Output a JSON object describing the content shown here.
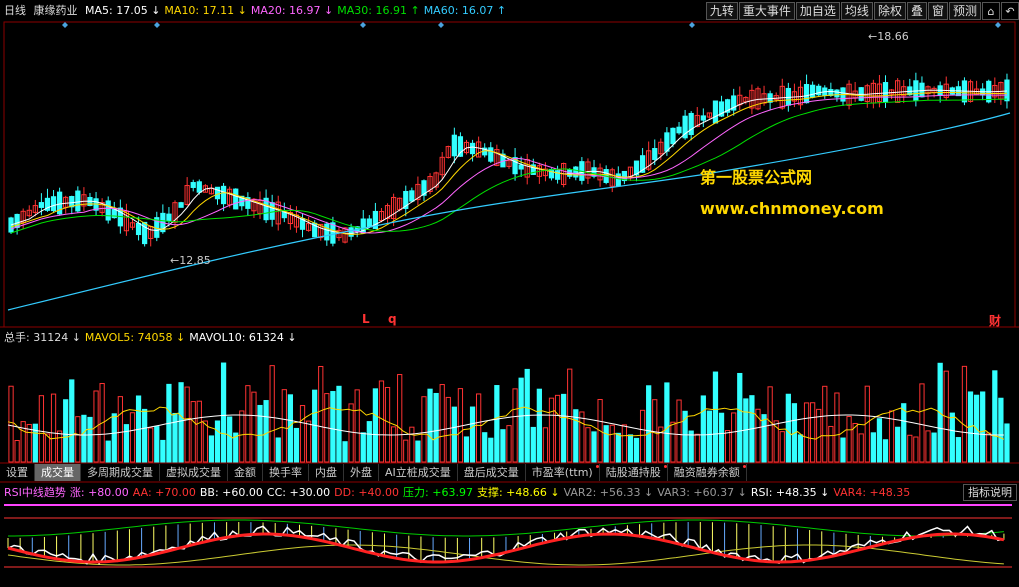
{
  "header": {
    "period": "日线",
    "stock": "康缘药业",
    "ma": [
      {
        "label": "MA5:",
        "value": "17.05",
        "arrow": "↓",
        "color": "#ffffff"
      },
      {
        "label": "MA10:",
        "value": "17.11",
        "arrow": "↓",
        "color": "#ffd800"
      },
      {
        "label": "MA20:",
        "value": "16.97",
        "arrow": "↓",
        "color": "#ff66ff"
      },
      {
        "label": "MA30:",
        "value": "16.91",
        "arrow": "↑",
        "color": "#00e000"
      },
      {
        "label": "MA60:",
        "value": "16.07",
        "arrow": "↑",
        "color": "#33ccff"
      }
    ]
  },
  "toolbar": {
    "buttons": [
      "九转",
      "重大事件",
      "加自选",
      "均线",
      "除权",
      "叠",
      "窗",
      "预测"
    ],
    "icons": [
      "lock-icon",
      "undo-icon"
    ]
  },
  "price_chart": {
    "high_label": "18.66",
    "low_label": "12.85",
    "markers": [
      "L",
      "q",
      "财"
    ],
    "watermark1": "第一股票公式网",
    "watermark2": "www.chnmoney.com"
  },
  "volume": {
    "items": [
      {
        "label": "总手:",
        "value": "31124",
        "arrow": "↓",
        "color": "#33ccff"
      },
      {
        "label": "MAVOL5:",
        "value": "74058",
        "arrow": "↓",
        "color": "#ffd800"
      },
      {
        "label": "MAVOL10:",
        "value": "61324",
        "arrow": "↓",
        "color": "#ffffff"
      }
    ]
  },
  "tabs": [
    "设置",
    "成交量",
    "多周期成交量",
    "虚拟成交量",
    "金额",
    "换手率",
    "内盘",
    "外盘",
    "AI立桩成交量",
    "盘后成交量",
    "市盈率(ttm)",
    "陆股通持股",
    "融资融券余额"
  ],
  "active_tab": "成交量",
  "indicator": {
    "name": "RSI中线趋势",
    "items": [
      {
        "label": "涨:",
        "value": "+80.00",
        "color": "#ff66ff"
      },
      {
        "label": "AA:",
        "value": "+70.00",
        "color": "#ff3333"
      },
      {
        "label": "BB:",
        "value": "+60.00",
        "color": "#ffffff"
      },
      {
        "label": "CC:",
        "value": "+30.00",
        "color": "#ffffff"
      },
      {
        "label": "DD:",
        "value": "+40.00",
        "color": "#ff3333"
      },
      {
        "label": "压力:",
        "value": "+63.97",
        "color": "#00ff00"
      },
      {
        "label": "支撑:",
        "value": "+48.66 ↓",
        "color": "#ffff00"
      },
      {
        "label": "VAR2:",
        "value": "+56.33 ↓",
        "color": "#999999"
      },
      {
        "label": "VAR3:",
        "value": "+60.37 ↓",
        "color": "#999999"
      },
      {
        "label": "RSI:",
        "value": "+48.35 ↓",
        "color": "#ffffff"
      },
      {
        "label": "VAR4:",
        "value": "+48.35",
        "color": "#ff3333"
      }
    ],
    "help": "指标说明"
  },
  "colors": {
    "up": "#ff3333",
    "down": "#33ffff",
    "bg": "#000000"
  }
}
